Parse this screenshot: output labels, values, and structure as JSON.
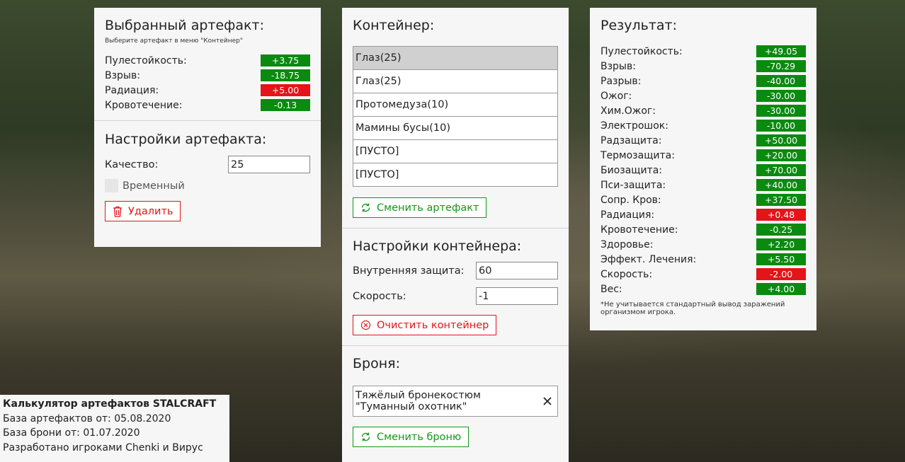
{
  "selected_artifact": {
    "title": "Выбранный артефакт:",
    "hint": "Выберите артефакт в меню \"Контейнер\"",
    "stats": [
      {
        "label": "Пулестойкость:",
        "value": "+3.75",
        "sign": "pos"
      },
      {
        "label": "Взрыв:",
        "value": "-18.75",
        "sign": "pos"
      },
      {
        "label": "Радиация:",
        "value": "+5.00",
        "sign": "neg"
      },
      {
        "label": "Кровотечение:",
        "value": "-0.13",
        "sign": "pos"
      }
    ]
  },
  "artifact_settings": {
    "title": "Настройки артефакта:",
    "quality_label": "Качество:",
    "quality_value": "25",
    "temporary_label": "Временный",
    "delete_label": "Удалить"
  },
  "container": {
    "title": "Контейнер:",
    "slots": [
      "Глаз(25)",
      "Глаз(25)",
      "Протомедуза(10)",
      "Мамины бусы(10)",
      "[ПУСТО]",
      "[ПУСТО]"
    ],
    "change_label": "Сменить артефакт"
  },
  "container_settings": {
    "title": "Настройки контейнера:",
    "protection_label": "Внутренняя защита:",
    "protection_value": "60",
    "speed_label": "Скорость:",
    "speed_value": "-1",
    "clear_label": "Очистить контейнер"
  },
  "armor": {
    "title": "Броня:",
    "selected": "Тяжёлый бронекостюм \"Туманный охотник\"",
    "change_label": "Сменить броню"
  },
  "result": {
    "title": "Результат:",
    "stats": [
      {
        "label": "Пулестойкость:",
        "value": "+49.05",
        "sign": "pos"
      },
      {
        "label": "Взрыв:",
        "value": "-70.29",
        "sign": "pos"
      },
      {
        "label": "Разрыв:",
        "value": "-40.00",
        "sign": "pos"
      },
      {
        "label": "Ожог:",
        "value": "-30.00",
        "sign": "pos"
      },
      {
        "label": "Хим.Ожог:",
        "value": "-30.00",
        "sign": "pos"
      },
      {
        "label": "Электрошок:",
        "value": "-10.00",
        "sign": "pos"
      },
      {
        "label": "Радзащита:",
        "value": "+50.00",
        "sign": "pos"
      },
      {
        "label": "Термозащита:",
        "value": "+20.00",
        "sign": "pos"
      },
      {
        "label": "Биозащита:",
        "value": "+70.00",
        "sign": "pos"
      },
      {
        "label": "Пси-защита:",
        "value": "+40.00",
        "sign": "pos"
      },
      {
        "label": "Сопр. Кров:",
        "value": "+37.50",
        "sign": "pos"
      },
      {
        "label": "Радиация:",
        "value": "+0.48",
        "sign": "neg"
      },
      {
        "label": "Кровотечение:",
        "value": "-0.25",
        "sign": "pos"
      },
      {
        "label": "Здоровье:",
        "value": "+2.20",
        "sign": "pos"
      },
      {
        "label": "Эффект. Лечения:",
        "value": "+5.50",
        "sign": "pos"
      },
      {
        "label": "Скорость:",
        "value": "-2.00",
        "sign": "neg"
      },
      {
        "label": "Вес:",
        "value": "+4.00",
        "sign": "pos"
      }
    ],
    "footnote": "*Не учитывается стандартный вывод заражений организмом игрока."
  },
  "info": {
    "title": "Калькулятор артефактов STALCRAFT",
    "artifacts_db": "База артефактов от: 05.08.2020",
    "armor_db": "База брони от: 01.07.2020",
    "authors": "Разработано игроками Chenki и Вирус"
  },
  "colors": {
    "positive": "#0b8a10",
    "negative": "#e4141a",
    "panel": "#f6f6f6"
  },
  "icons": [
    "trash-icon",
    "refresh-icon",
    "clear-circle-icon",
    "close-icon"
  ]
}
